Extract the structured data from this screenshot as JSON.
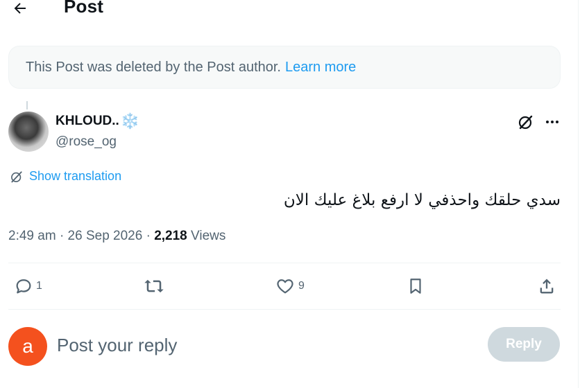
{
  "header": {
    "title": "Post",
    "back_icon": "arrow-left-icon"
  },
  "notice": {
    "text": "This Post was deleted by the Post author.",
    "link": "Learn more"
  },
  "post": {
    "author_name": "KHLOUD..",
    "author_emoji": "❄️",
    "handle": "@rose_og",
    "translate_label": "Show translation",
    "text": "سدي حلقك واحذفي لا ارفع بلاغ عليك الان",
    "time": "2:49 am",
    "date": "26 Sep 2026",
    "views_count": "2,218",
    "views_label": "Views"
  },
  "actions": {
    "replies": "1",
    "reposts": "",
    "likes": "9"
  },
  "reply": {
    "avatar_letter": "a",
    "placeholder": "Post your reply",
    "button": "Reply"
  },
  "colors": {
    "accent": "#1d9bf0",
    "secondary_text": "#536471",
    "reply_avatar": "#f4511e",
    "disabled_button": "#cfd9de"
  }
}
